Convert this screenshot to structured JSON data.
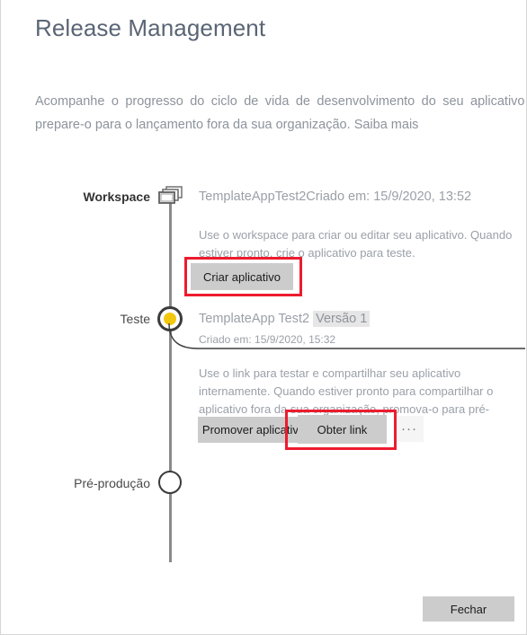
{
  "dialog": {
    "title": "Release Management",
    "intro": {
      "text": "Acompanhe o progresso do ciclo de vida de desenvolvimento do seu aplicativo e prepare-o para o lançamento fora da sua organização.",
      "learn_more": "Saiba mais"
    },
    "close_button": "Fechar"
  },
  "timeline": {
    "stages": [
      {
        "label": "Workspace",
        "icon": "stacked-windows-icon",
        "item_name": "TemplateAppTest2",
        "item_meta": "Criado em: 15/9/2020, 13:52",
        "description": "Use o workspace para criar ou editar seu aplicativo. Quando estiver pronto, crie o aplicativo para teste.",
        "action": "Criar aplicativo"
      },
      {
        "label": "Teste",
        "icon": "filled-circle-marker",
        "item_name": "TemplateApp Test2",
        "item_version": "Versão 1",
        "item_sub": "Criado em: 15/9/2020, 15:32",
        "description": "Use o link para testar e compartilhar seu aplicativo internamente. Quando estiver pronto para compartilhar o aplicativo fora da sua organização, promova-o para pré-produção.",
        "action_primary": "Promover aplicativo",
        "action_secondary": "Obter link",
        "action_more": "···"
      },
      {
        "label": "Pré-produção",
        "icon": "empty-circle-marker"
      }
    ]
  },
  "colors": {
    "title": "#5a6575",
    "muted_text": "#9aa0a8",
    "marker_active": "#f2c80f",
    "annotation": "#ed1b2e",
    "button_bg": "#cccccc"
  }
}
